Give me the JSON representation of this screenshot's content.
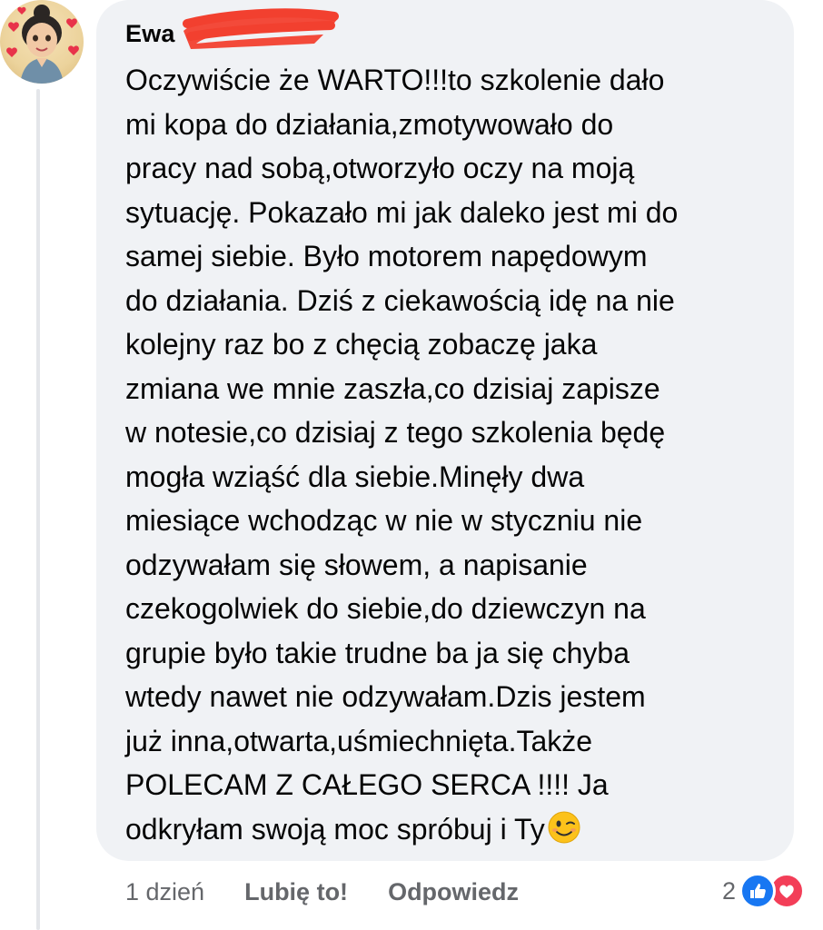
{
  "comment": {
    "author_name": "Ewa",
    "text": "Oczywiście że WARTO!!!to szkolenie dało\nmi kopa do działania,zmotywowało do\npracy nad sobą,otworzyło oczy na moją\nsytuację. Pokazało mi jak daleko jest mi do\nsamej siebie. Było motorem napędowym\ndo działania. Dziś z ciekawością idę na nie\nkolejny raz bo z chęcią zobaczę jaka\nzmiana we mnie zaszła,co dzisiaj zapisze\nw notesie,co dzisiaj z tego szkolenia będę\nmogła wziąść dla siebie.Minęły dwa\nmiesiące wchodząc w nie w styczniu nie\nodzywałam się słowem, a napisanie\nczekogolwiek do siebie,do dziewczyn na\ngrupie było takie trudne ba ja się chyba\nwtedy nawet nie odzywałam.Dzis jestem\njuż inna,otwarta,uśmiechnięta.Także\nPOLECAM Z CAŁEGO SERCA !!!! Ja\nodkryłam swoją moc spróbuj i Ty",
    "trailing_emoji": "winking-face-emoji",
    "timestamp": "1 dzień",
    "like_label": "Lubię to!",
    "reply_label": "Odpowiedz",
    "reaction_count": "2",
    "reaction_icons": [
      "like-icon",
      "love-icon"
    ]
  },
  "colors": {
    "bubble_bg": "#f0f2f5",
    "text": "#050505",
    "secondary_text": "#65676b",
    "like_blue": "#1877f2",
    "love_red": "#f33e58",
    "redaction_red": "#f2402f"
  }
}
